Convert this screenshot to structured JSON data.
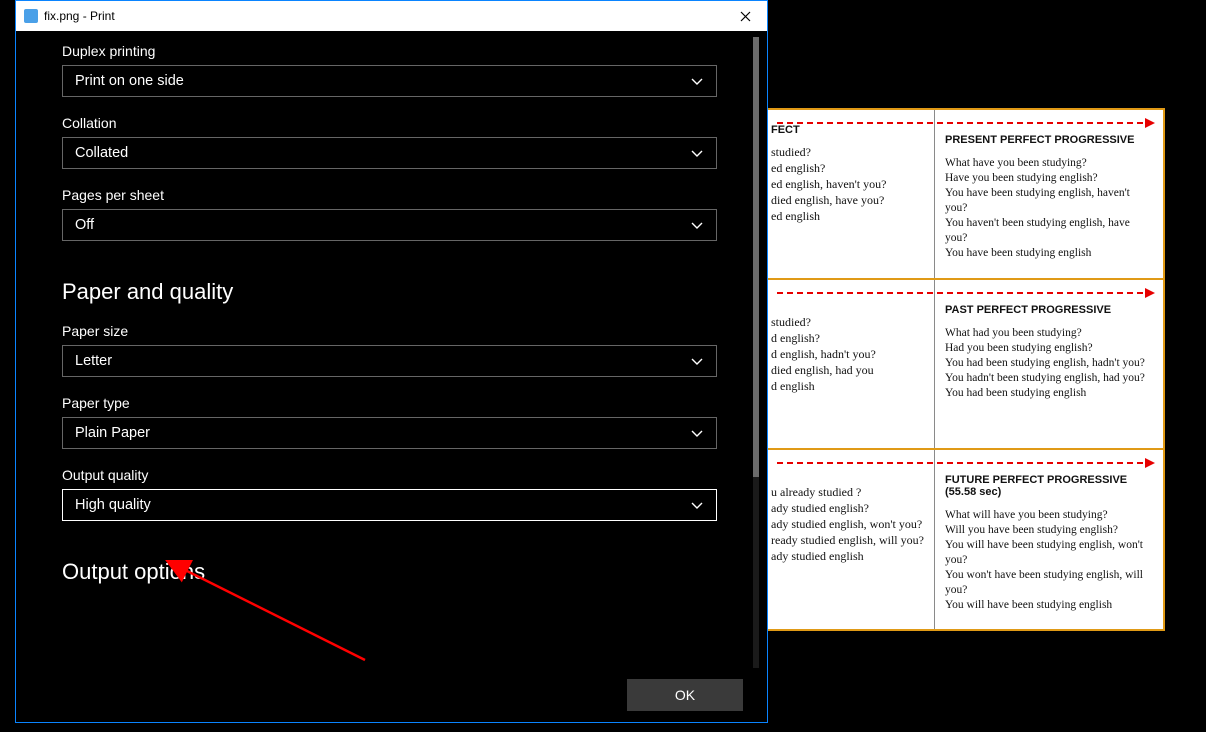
{
  "window": {
    "title": "fix.png - Print"
  },
  "dialog": {
    "fields": {
      "duplex": {
        "label": "Duplex printing",
        "value": "Print on one side"
      },
      "collation": {
        "label": "Collation",
        "value": "Collated"
      },
      "pps": {
        "label": "Pages per sheet",
        "value": "Off"
      },
      "paper_size": {
        "label": "Paper size",
        "value": "Letter"
      },
      "paper_type": {
        "label": "Paper type",
        "value": "Plain Paper"
      },
      "output_quality": {
        "label": "Output quality",
        "value": "High quality"
      }
    },
    "section_paper": "Paper and quality",
    "section_output": "Output options",
    "ok": "OK"
  },
  "preview": {
    "cards": [
      {
        "left_head": "FECT",
        "left": [
          "studied?",
          "ed english?",
          "ed english, haven't you?",
          "died english, have you?",
          "ed english"
        ],
        "right_head": "PRESENT PERFECT PROGRESSIVE",
        "right": [
          "What have you been studying?",
          "Have you been studying  english?",
          "You have been studying  english,  haven't you?",
          "You haven't been studying  english,  have you?",
          "You have been studying  english"
        ]
      },
      {
        "left_head": "",
        "left": [
          "studied?",
          "d english?",
          "d english, hadn't you?",
          "died english,  had you",
          "d english"
        ],
        "right_head": "PAST PERFECT PROGRESSIVE",
        "right": [
          "What had you been studying?",
          "Had you been studying  english?",
          "You had been studying  english,  hadn't you?",
          "You hadn't been studying  english,  had you?",
          "You had been studying  english"
        ]
      },
      {
        "left_head": "",
        "left": [
          "u already studied ?",
          "ady studied english?",
          "ady studied english, won't you?",
          "ready studied english, will you?",
          "ady studied english"
        ],
        "right_head": "FUTURE PERFECT PROGRESSIVE  (55.58 sec)",
        "right": [
          "What will have you been studying?",
          "Will you have been studying  english?",
          "You will have been studying  english,  won't you?",
          "You won't have been  studying  english,  will you?",
          "You will have been studying  english"
        ]
      }
    ]
  }
}
